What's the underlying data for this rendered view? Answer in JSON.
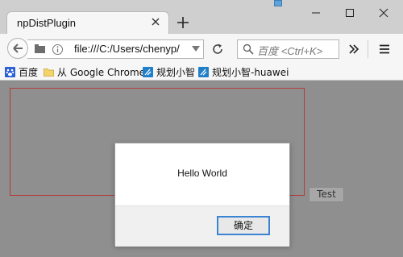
{
  "tab": {
    "title": "npDistPlugin"
  },
  "nav": {
    "url": "file:///C:/Users/chenyp/",
    "search_placeholder": "百度 <Ctrl+K>"
  },
  "bookmarks": [
    {
      "label": "百度",
      "icon": "baidu-paw-icon"
    },
    {
      "label": "从 Google Chrome",
      "icon": "folder-icon"
    },
    {
      "label": "规划小智",
      "icon": "app-icon"
    },
    {
      "label": "规划小智-huawei",
      "icon": "app-icon"
    }
  ],
  "page": {
    "test_button": "Test"
  },
  "dialog": {
    "message": "Hello World",
    "ok_label": "确定"
  },
  "colors": {
    "content_bg": "#8f8f8f",
    "red_border": "#b43a3a",
    "ok_border": "#3b84d4"
  }
}
